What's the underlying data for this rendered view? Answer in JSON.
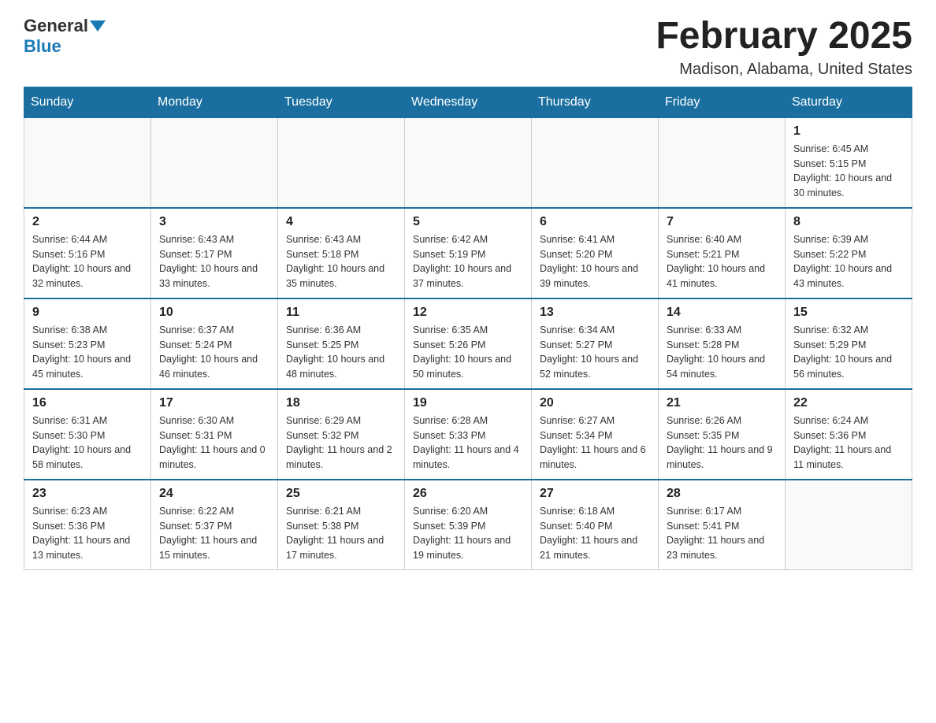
{
  "header": {
    "logo_general": "General",
    "logo_blue": "Blue",
    "month_title": "February 2025",
    "location": "Madison, Alabama, United States"
  },
  "days_of_week": [
    "Sunday",
    "Monday",
    "Tuesday",
    "Wednesday",
    "Thursday",
    "Friday",
    "Saturday"
  ],
  "weeks": [
    [
      {
        "day": "",
        "info": ""
      },
      {
        "day": "",
        "info": ""
      },
      {
        "day": "",
        "info": ""
      },
      {
        "day": "",
        "info": ""
      },
      {
        "day": "",
        "info": ""
      },
      {
        "day": "",
        "info": ""
      },
      {
        "day": "1",
        "info": "Sunrise: 6:45 AM\nSunset: 5:15 PM\nDaylight: 10 hours and 30 minutes."
      }
    ],
    [
      {
        "day": "2",
        "info": "Sunrise: 6:44 AM\nSunset: 5:16 PM\nDaylight: 10 hours and 32 minutes."
      },
      {
        "day": "3",
        "info": "Sunrise: 6:43 AM\nSunset: 5:17 PM\nDaylight: 10 hours and 33 minutes."
      },
      {
        "day": "4",
        "info": "Sunrise: 6:43 AM\nSunset: 5:18 PM\nDaylight: 10 hours and 35 minutes."
      },
      {
        "day": "5",
        "info": "Sunrise: 6:42 AM\nSunset: 5:19 PM\nDaylight: 10 hours and 37 minutes."
      },
      {
        "day": "6",
        "info": "Sunrise: 6:41 AM\nSunset: 5:20 PM\nDaylight: 10 hours and 39 minutes."
      },
      {
        "day": "7",
        "info": "Sunrise: 6:40 AM\nSunset: 5:21 PM\nDaylight: 10 hours and 41 minutes."
      },
      {
        "day": "8",
        "info": "Sunrise: 6:39 AM\nSunset: 5:22 PM\nDaylight: 10 hours and 43 minutes."
      }
    ],
    [
      {
        "day": "9",
        "info": "Sunrise: 6:38 AM\nSunset: 5:23 PM\nDaylight: 10 hours and 45 minutes."
      },
      {
        "day": "10",
        "info": "Sunrise: 6:37 AM\nSunset: 5:24 PM\nDaylight: 10 hours and 46 minutes."
      },
      {
        "day": "11",
        "info": "Sunrise: 6:36 AM\nSunset: 5:25 PM\nDaylight: 10 hours and 48 minutes."
      },
      {
        "day": "12",
        "info": "Sunrise: 6:35 AM\nSunset: 5:26 PM\nDaylight: 10 hours and 50 minutes."
      },
      {
        "day": "13",
        "info": "Sunrise: 6:34 AM\nSunset: 5:27 PM\nDaylight: 10 hours and 52 minutes."
      },
      {
        "day": "14",
        "info": "Sunrise: 6:33 AM\nSunset: 5:28 PM\nDaylight: 10 hours and 54 minutes."
      },
      {
        "day": "15",
        "info": "Sunrise: 6:32 AM\nSunset: 5:29 PM\nDaylight: 10 hours and 56 minutes."
      }
    ],
    [
      {
        "day": "16",
        "info": "Sunrise: 6:31 AM\nSunset: 5:30 PM\nDaylight: 10 hours and 58 minutes."
      },
      {
        "day": "17",
        "info": "Sunrise: 6:30 AM\nSunset: 5:31 PM\nDaylight: 11 hours and 0 minutes."
      },
      {
        "day": "18",
        "info": "Sunrise: 6:29 AM\nSunset: 5:32 PM\nDaylight: 11 hours and 2 minutes."
      },
      {
        "day": "19",
        "info": "Sunrise: 6:28 AM\nSunset: 5:33 PM\nDaylight: 11 hours and 4 minutes."
      },
      {
        "day": "20",
        "info": "Sunrise: 6:27 AM\nSunset: 5:34 PM\nDaylight: 11 hours and 6 minutes."
      },
      {
        "day": "21",
        "info": "Sunrise: 6:26 AM\nSunset: 5:35 PM\nDaylight: 11 hours and 9 minutes."
      },
      {
        "day": "22",
        "info": "Sunrise: 6:24 AM\nSunset: 5:36 PM\nDaylight: 11 hours and 11 minutes."
      }
    ],
    [
      {
        "day": "23",
        "info": "Sunrise: 6:23 AM\nSunset: 5:36 PM\nDaylight: 11 hours and 13 minutes."
      },
      {
        "day": "24",
        "info": "Sunrise: 6:22 AM\nSunset: 5:37 PM\nDaylight: 11 hours and 15 minutes."
      },
      {
        "day": "25",
        "info": "Sunrise: 6:21 AM\nSunset: 5:38 PM\nDaylight: 11 hours and 17 minutes."
      },
      {
        "day": "26",
        "info": "Sunrise: 6:20 AM\nSunset: 5:39 PM\nDaylight: 11 hours and 19 minutes."
      },
      {
        "day": "27",
        "info": "Sunrise: 6:18 AM\nSunset: 5:40 PM\nDaylight: 11 hours and 21 minutes."
      },
      {
        "day": "28",
        "info": "Sunrise: 6:17 AM\nSunset: 5:41 PM\nDaylight: 11 hours and 23 minutes."
      },
      {
        "day": "",
        "info": ""
      }
    ]
  ]
}
